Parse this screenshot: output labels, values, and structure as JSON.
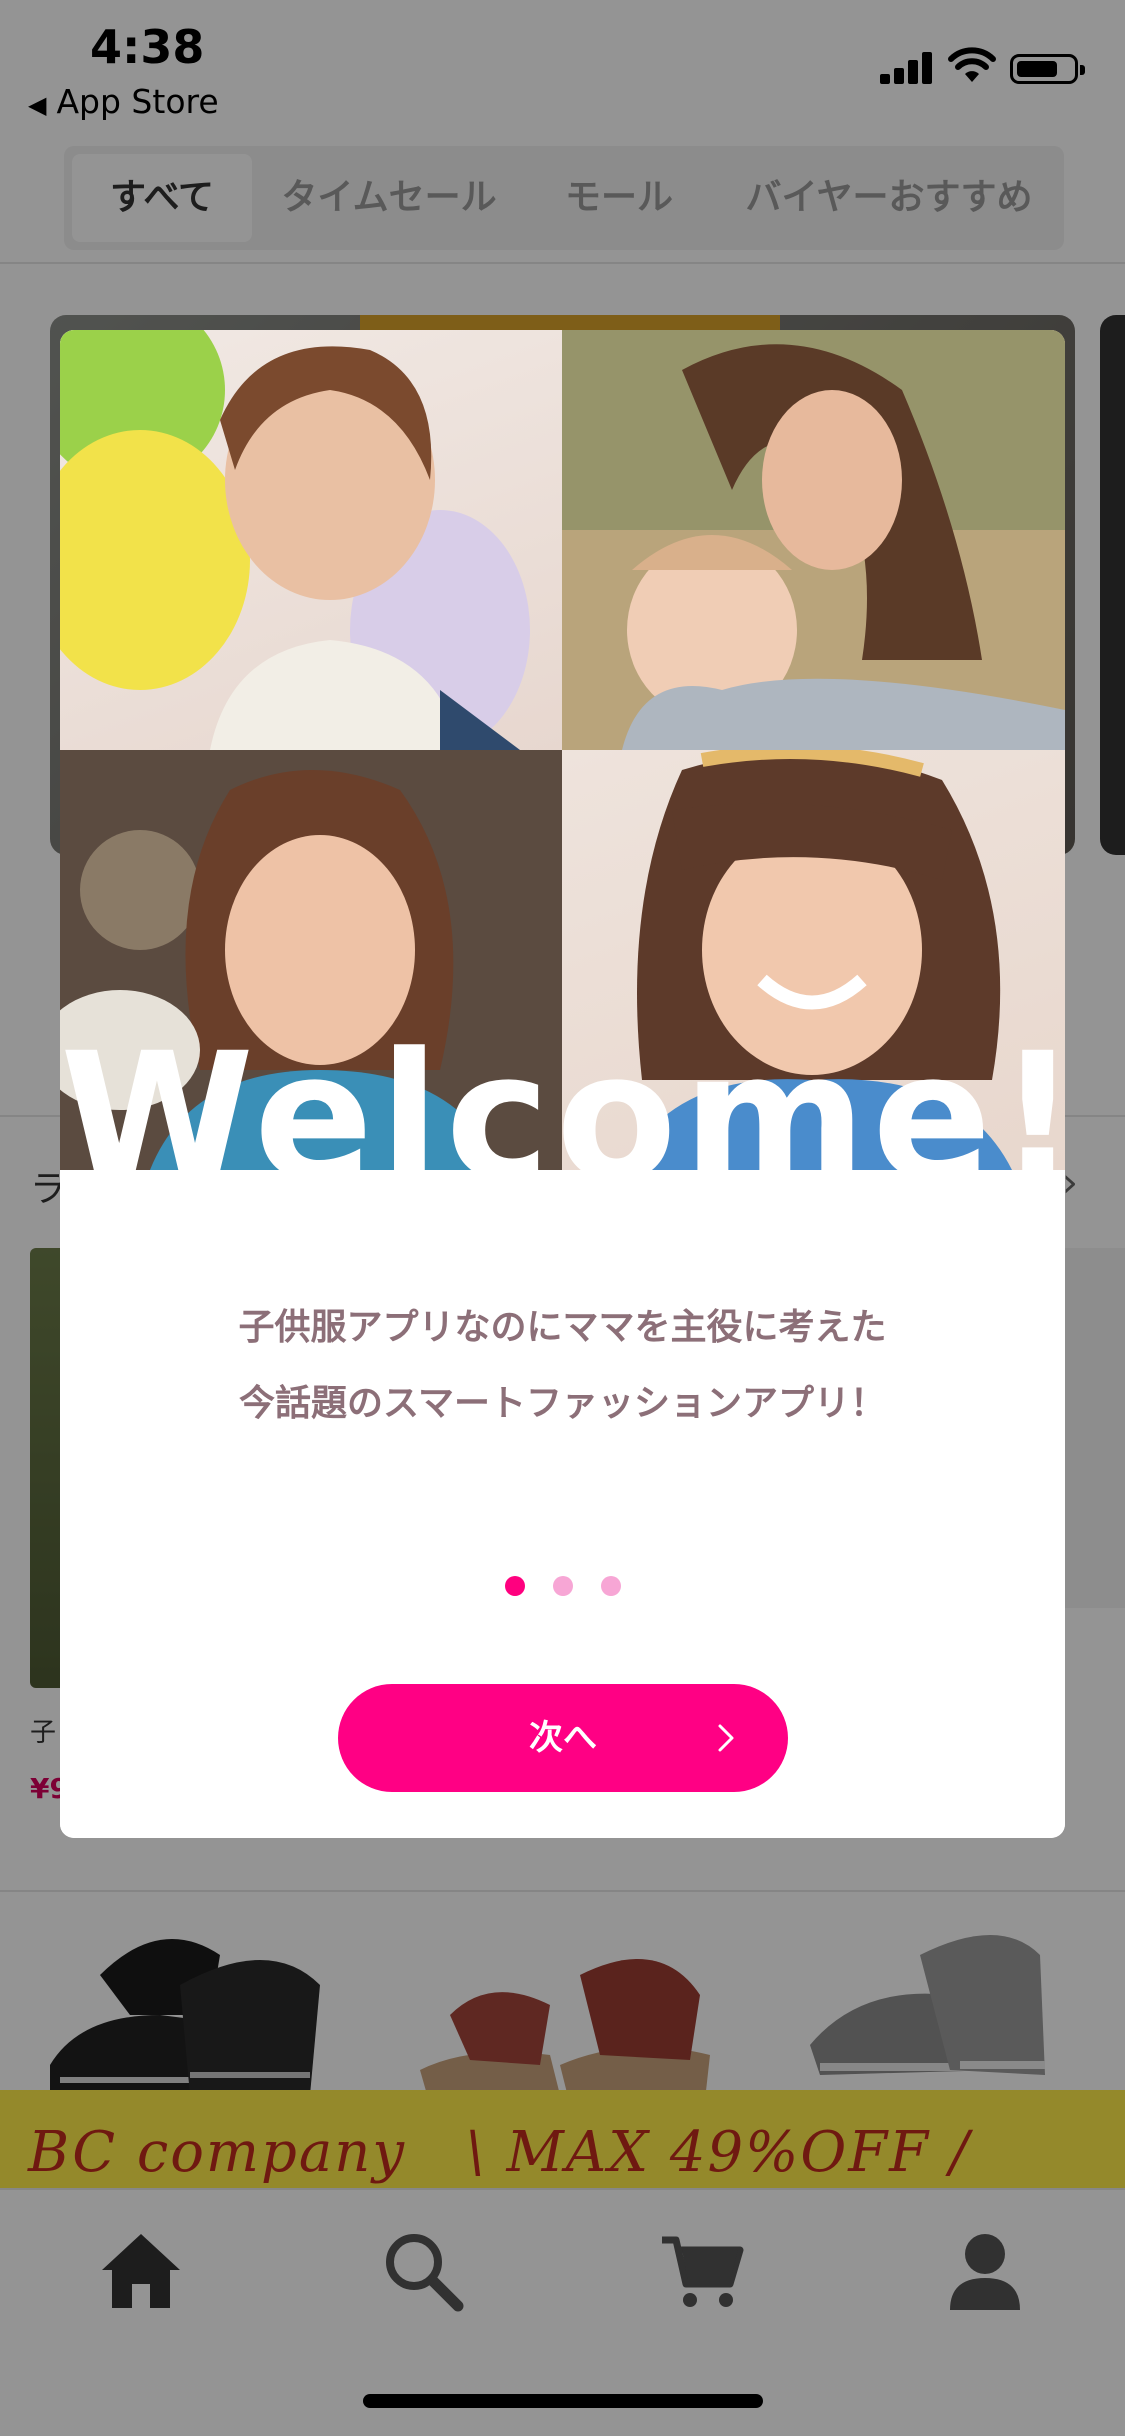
{
  "status_bar": {
    "time": "4:38",
    "back_label": "App Store"
  },
  "tabs": [
    {
      "label": "すべて",
      "active": true
    },
    {
      "label": "タイムセール",
      "active": false
    },
    {
      "label": "モール",
      "active": false
    },
    {
      "label": "バイヤーおすすめ",
      "active": false
    }
  ],
  "background": {
    "section_label_partial": "ラ",
    "product_name_partial": "子",
    "product_price_partial": "¥9",
    "promo": {
      "brand": "BC company",
      "text": "\\ MAX 49%OFF /"
    }
  },
  "modal": {
    "headline": "Welcome!!",
    "tagline_line1": "子供服アプリなのにママを主役に考えた",
    "tagline_line2": "今話題のスマートファッションアプリ！",
    "pagination": {
      "total": 3,
      "current": 1
    },
    "next_label": "次へ",
    "accent_color": "#ff0084"
  },
  "bottom_nav": [
    {
      "icon": "home-icon"
    },
    {
      "icon": "search-icon"
    },
    {
      "icon": "cart-icon"
    },
    {
      "icon": "user-icon"
    }
  ]
}
